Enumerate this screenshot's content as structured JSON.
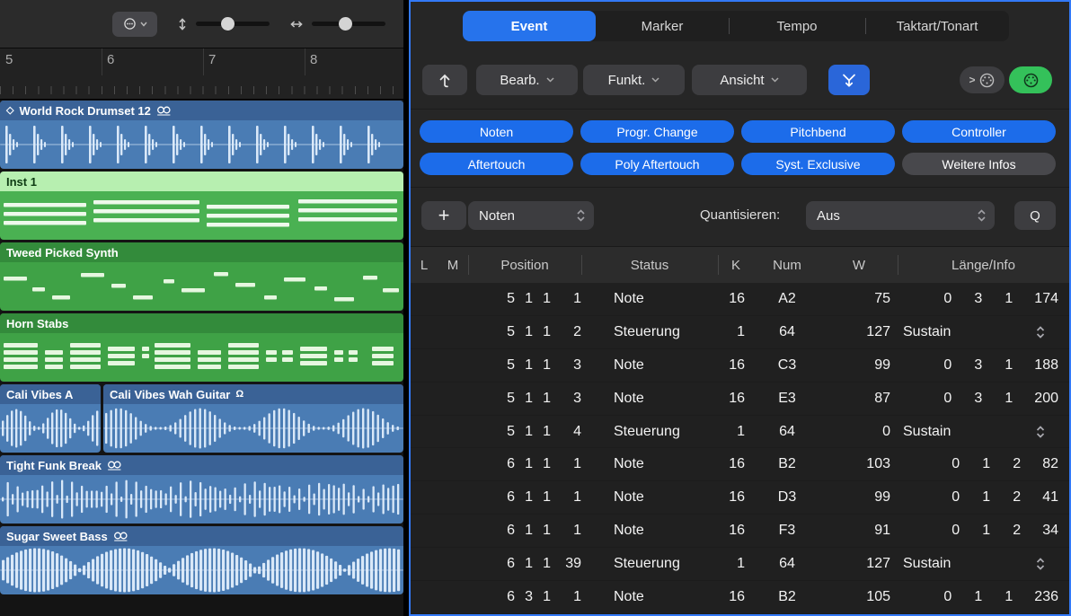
{
  "colors": {
    "accent_blue": "#2673ec",
    "filter_blue": "#1c6cea",
    "panel_focus_border": "#3379f6",
    "midi_out_green": "#34c15a",
    "audio_region_blue": "#4a7cb4",
    "midi_region_green": "#3fa246",
    "selected_region_header": "#b7efb0"
  },
  "left_panel": {
    "ruler_numbers": [
      "5",
      "6",
      "7",
      "8"
    ],
    "tracks": [
      {
        "name": "World Rock Drumset 12",
        "kind": "audio",
        "badge": "loop"
      },
      {
        "name": "Inst 1",
        "kind": "midi",
        "selected": true
      },
      {
        "name": "Tweed Picked Synth",
        "kind": "midi"
      },
      {
        "name": "Horn Stabs",
        "kind": "midi"
      },
      {
        "name": "Cali Vibes A",
        "kind": "audio"
      },
      {
        "name": "Cali Vibes Wah Guitar",
        "kind": "audio",
        "badge": "omega"
      },
      {
        "name": "Tight Funk Break",
        "kind": "audio",
        "badge": "loop"
      },
      {
        "name": "Sugar Sweet Bass",
        "kind": "audio",
        "badge": "loop"
      }
    ]
  },
  "event_list": {
    "tabs": [
      {
        "label": "Event",
        "active": true
      },
      {
        "label": "Marker",
        "active": false
      },
      {
        "label": "Tempo",
        "active": false
      },
      {
        "label": "Taktart/Tonart",
        "active": false
      }
    ],
    "menus": [
      {
        "label": "Bearb."
      },
      {
        "label": "Funkt."
      },
      {
        "label": "Ansicht"
      }
    ],
    "filters": [
      {
        "label": "Noten",
        "active": true
      },
      {
        "label": "Progr. Change",
        "active": true
      },
      {
        "label": "Pitchbend",
        "active": true
      },
      {
        "label": "Controller",
        "active": true
      },
      {
        "label": "Aftertouch",
        "active": true
      },
      {
        "label": "Poly Aftertouch",
        "active": true
      },
      {
        "label": "Syst. Exclusive",
        "active": true
      },
      {
        "label": "Weitere Infos",
        "active": false
      }
    ],
    "insert_row": {
      "add_label": "+",
      "event_type": "Noten",
      "quantize_label": "Quantisieren:",
      "quantize_value": "Aus",
      "q_label": "Q"
    },
    "table": {
      "headers": [
        "L",
        "M",
        "Position",
        "Status",
        "K",
        "Num",
        "W",
        "Länge/Info"
      ],
      "rows": [
        {
          "position": [
            "5",
            "1",
            "1"
          ],
          "tick": "1",
          "status": "Note",
          "k": "16",
          "num": "A2",
          "w": "75",
          "info": [
            "0",
            "3",
            "1",
            "174"
          ]
        },
        {
          "position": [
            "5",
            "1",
            "1"
          ],
          "tick": "2",
          "status": "Steuerung",
          "k": "1",
          "num": "64",
          "w": "127",
          "info_text": "Sustain",
          "stepper": true
        },
        {
          "position": [
            "5",
            "1",
            "1"
          ],
          "tick": "3",
          "status": "Note",
          "k": "16",
          "num": "C3",
          "w": "99",
          "info": [
            "0",
            "3",
            "1",
            "188"
          ]
        },
        {
          "position": [
            "5",
            "1",
            "1"
          ],
          "tick": "3",
          "status": "Note",
          "k": "16",
          "num": "E3",
          "w": "87",
          "info": [
            "0",
            "3",
            "1",
            "200"
          ]
        },
        {
          "position": [
            "5",
            "1",
            "1"
          ],
          "tick": "4",
          "status": "Steuerung",
          "k": "1",
          "num": "64",
          "w": "0",
          "info_text": "Sustain",
          "stepper": true
        },
        {
          "position": [
            "6",
            "1",
            "1"
          ],
          "tick": "1",
          "status": "Note",
          "k": "16",
          "num": "B2",
          "w": "103",
          "info": [
            "0",
            "1",
            "2",
            "82"
          ]
        },
        {
          "position": [
            "6",
            "1",
            "1"
          ],
          "tick": "1",
          "status": "Note",
          "k": "16",
          "num": "D3",
          "w": "99",
          "info": [
            "0",
            "1",
            "2",
            "41"
          ]
        },
        {
          "position": [
            "6",
            "1",
            "1"
          ],
          "tick": "1",
          "status": "Note",
          "k": "16",
          "num": "F3",
          "w": "91",
          "info": [
            "0",
            "1",
            "2",
            "34"
          ]
        },
        {
          "position": [
            "6",
            "1",
            "1"
          ],
          "tick": "39",
          "status": "Steuerung",
          "k": "1",
          "num": "64",
          "w": "127",
          "info_text": "Sustain",
          "stepper": true
        },
        {
          "position": [
            "6",
            "3",
            "1"
          ],
          "tick": "1",
          "status": "Note",
          "k": "16",
          "num": "B2",
          "w": "105",
          "info": [
            "0",
            "1",
            "1",
            "236"
          ]
        }
      ]
    }
  }
}
